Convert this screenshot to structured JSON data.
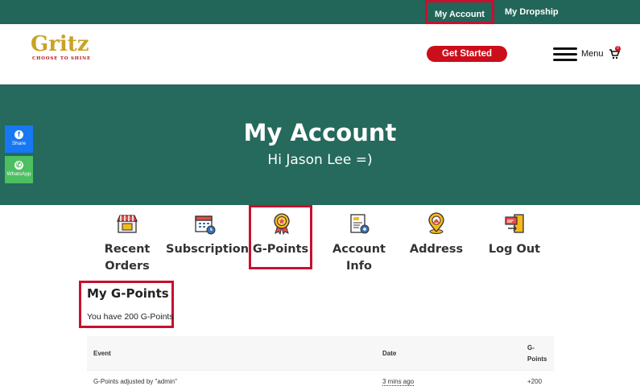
{
  "topbar": {
    "account": "My Account",
    "dropship": "My Dropship"
  },
  "header": {
    "logo_text": "Gritz",
    "logo_tagline": "CHOOSE TO SHINE",
    "cta": "Get Started",
    "menu": "Menu",
    "cart_count": "0"
  },
  "hero": {
    "title": "My Account",
    "greeting": "Hi Jason Lee =)"
  },
  "social": {
    "share": "Share",
    "whatsapp": "WhatsApp"
  },
  "nav": [
    {
      "label": "Recent Orders",
      "icon": "shop-icon"
    },
    {
      "label": "Subscription",
      "icon": "calendar-icon"
    },
    {
      "label": "G-Points",
      "icon": "medal-icon"
    },
    {
      "label": "Account Info",
      "icon": "document-gear-icon"
    },
    {
      "label": "Address",
      "icon": "location-pin-icon"
    },
    {
      "label": "Log Out",
      "icon": "logout-icon"
    }
  ],
  "gpoints": {
    "title": "My G-Points",
    "summary": "You have 200 G-Points",
    "columns": {
      "event": "Event",
      "date": "Date",
      "points_l1": "G-",
      "points_l2": "Points"
    },
    "rows": [
      {
        "event": "G-Points adjusted by \"admin\"",
        "date": "3 mins ago",
        "points": "+200"
      }
    ]
  },
  "colors": {
    "brand_green": "#256a5c",
    "cta_red": "#cc0e1b",
    "highlight": "#c8102e"
  }
}
